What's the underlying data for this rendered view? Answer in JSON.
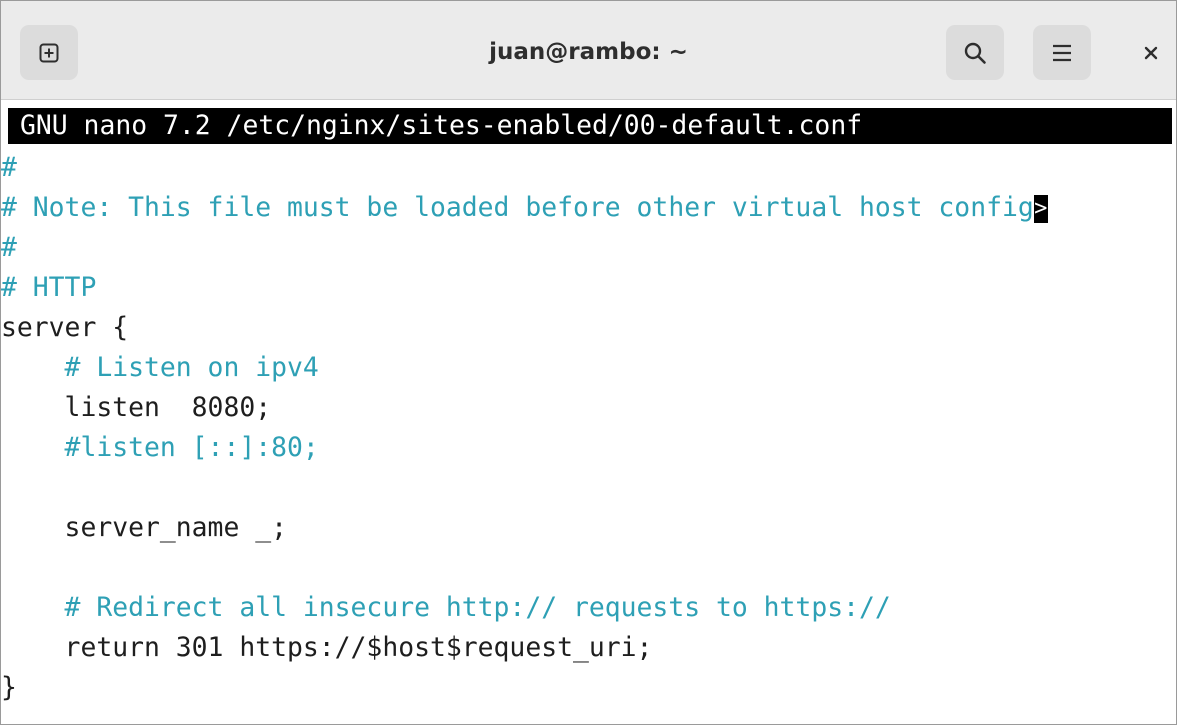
{
  "window": {
    "title": "juan@rambo: ~"
  },
  "icons": {
    "new_tab": "new-tab-icon",
    "search": "search-icon",
    "menu": "hamburger-menu-icon",
    "close": "close-icon"
  },
  "nano": {
    "header": "GNU nano 7.2 /etc/nginx/sites-enabled/00-default.conf",
    "overflow_marker": ">",
    "lines": [
      {
        "text": "#",
        "kind": "comment"
      },
      {
        "text": "# Note: This file must be loaded before other virtual host config",
        "kind": "comment"
      },
      {
        "text": "#",
        "kind": "comment"
      },
      {
        "text": "# HTTP",
        "kind": "comment"
      },
      {
        "text": "server {",
        "kind": "code"
      },
      {
        "text": "    # Listen on ipv4",
        "kind": "comment"
      },
      {
        "text": "    listen  8080;",
        "kind": "code"
      },
      {
        "text": "    #listen [::]:80;",
        "kind": "comment"
      },
      {
        "text": "",
        "kind": "code"
      },
      {
        "text": "    server_name _;",
        "kind": "code"
      },
      {
        "text": "",
        "kind": "code"
      },
      {
        "text": "    # Redirect all insecure http:// requests to https://",
        "kind": "comment"
      },
      {
        "text": "    return 301 https://$host$request_uri;",
        "kind": "code"
      },
      {
        "text": "}",
        "kind": "code"
      }
    ]
  },
  "colors": {
    "comment": "#2ea0b5",
    "text": "#1e1e1e",
    "header_bg": "#000000",
    "titlebar_bg": "#ebebeb"
  }
}
